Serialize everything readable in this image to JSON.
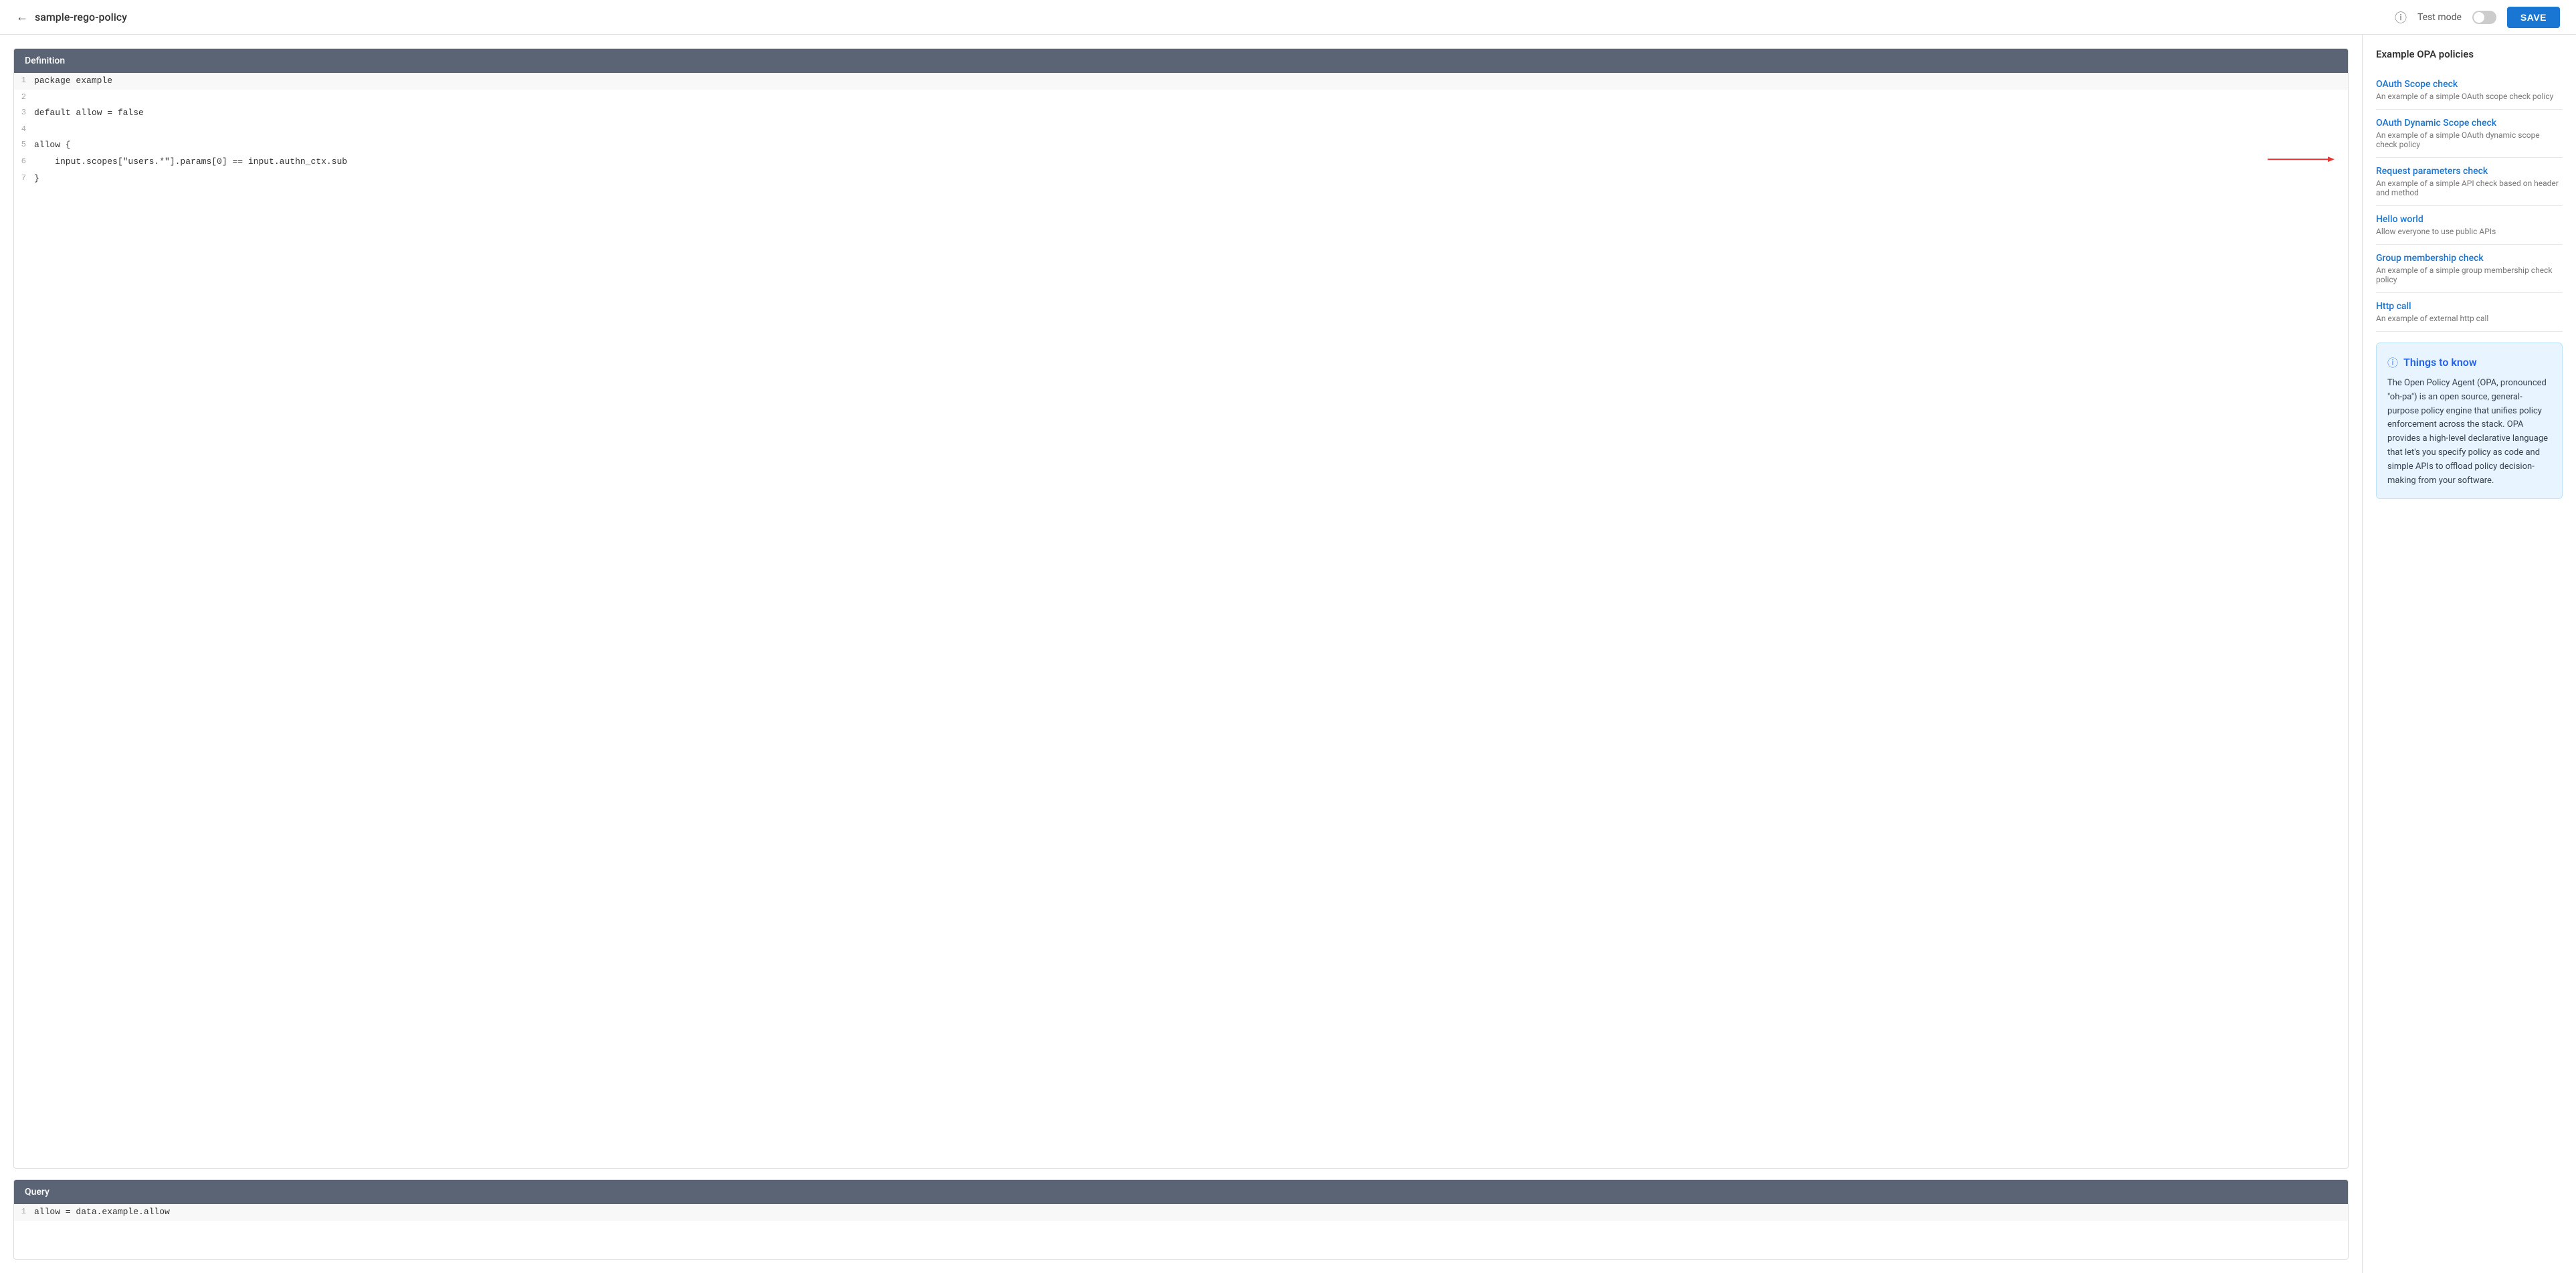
{
  "header": {
    "title": "sample-rego-policy",
    "back_label": "←",
    "help_label": "?",
    "test_mode_label": "Test mode",
    "save_label": "SAVE"
  },
  "definition_panel": {
    "header": "Definition",
    "lines": [
      {
        "num": "1",
        "code": "package example"
      },
      {
        "num": "2",
        "code": ""
      },
      {
        "num": "3",
        "code": "default allow = false"
      },
      {
        "num": "4",
        "code": ""
      },
      {
        "num": "5",
        "code": "allow {"
      },
      {
        "num": "6",
        "code": "    input.scopes[\"users.*\"].params[0] == input.authn_ctx.sub",
        "has_arrow": true
      },
      {
        "num": "7",
        "code": "}"
      }
    ]
  },
  "query_panel": {
    "header": "Query",
    "lines": [
      {
        "num": "1",
        "code": "allow = data.example.allow"
      }
    ]
  },
  "sidebar": {
    "title": "Example OPA policies",
    "policies": [
      {
        "title": "OAuth Scope check",
        "desc": "An example of a simple OAuth scope check policy"
      },
      {
        "title": "OAuth Dynamic Scope check",
        "desc": "An example of a simple OAuth dynamic scope check policy"
      },
      {
        "title": "Request parameters check",
        "desc": "An example of a simple API check based on header and method"
      },
      {
        "title": "Hello world",
        "desc": "Allow everyone to use public APIs"
      },
      {
        "title": "Group membership check",
        "desc": "An example of a simple group membership check policy"
      },
      {
        "title": "Http call",
        "desc": "An example of external http call"
      }
    ],
    "things_to_know": {
      "title": "Things to know",
      "body": "The Open Policy Agent (OPA, pronounced \"oh-pa\") is an open source, general-purpose policy engine that unifies policy enforcement across the stack. OPA provides a high-level declarative language that let's you specify policy as code and simple APIs to offload policy decision-making from your software."
    }
  }
}
